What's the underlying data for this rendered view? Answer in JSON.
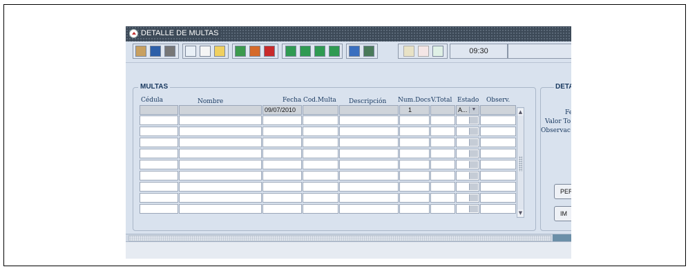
{
  "window": {
    "title": "DETALLE DE MULTAS"
  },
  "toolbar": {
    "clock": "09:30",
    "icons": [
      "broom-icon",
      "save-icon",
      "print-icon",
      "search-icon",
      "list-icon",
      "edit-icon",
      "insert-record-icon",
      "duplicate-record-icon",
      "delete-record-icon",
      "first-record-icon",
      "previous-record-icon",
      "next-record-icon",
      "last-record-icon",
      "help-icon",
      "exit-icon",
      "anchor-icon",
      "check-icon",
      "calendar-icon"
    ]
  },
  "multas": {
    "title": "MULTAS",
    "columns": [
      "Cédula",
      "Nombre",
      "Fecha",
      "Cod.Multa",
      "Descripción",
      "Num.Docs",
      "V.Total",
      "Estado",
      "Observ."
    ],
    "first_row": {
      "cedula": "",
      "nombre": "",
      "fecha": "09/07/2010",
      "cod_multa": "",
      "descripcion": "",
      "num_docs": "1",
      "v_total": "",
      "estado": "A...",
      "observ": ""
    }
  },
  "detalle": {
    "title": "DETA",
    "labels": {
      "fecha": "Fe",
      "valor_total": "Valor To",
      "observacion": "Observac"
    },
    "buttons": {
      "per": "PER",
      "im": "IM"
    }
  }
}
